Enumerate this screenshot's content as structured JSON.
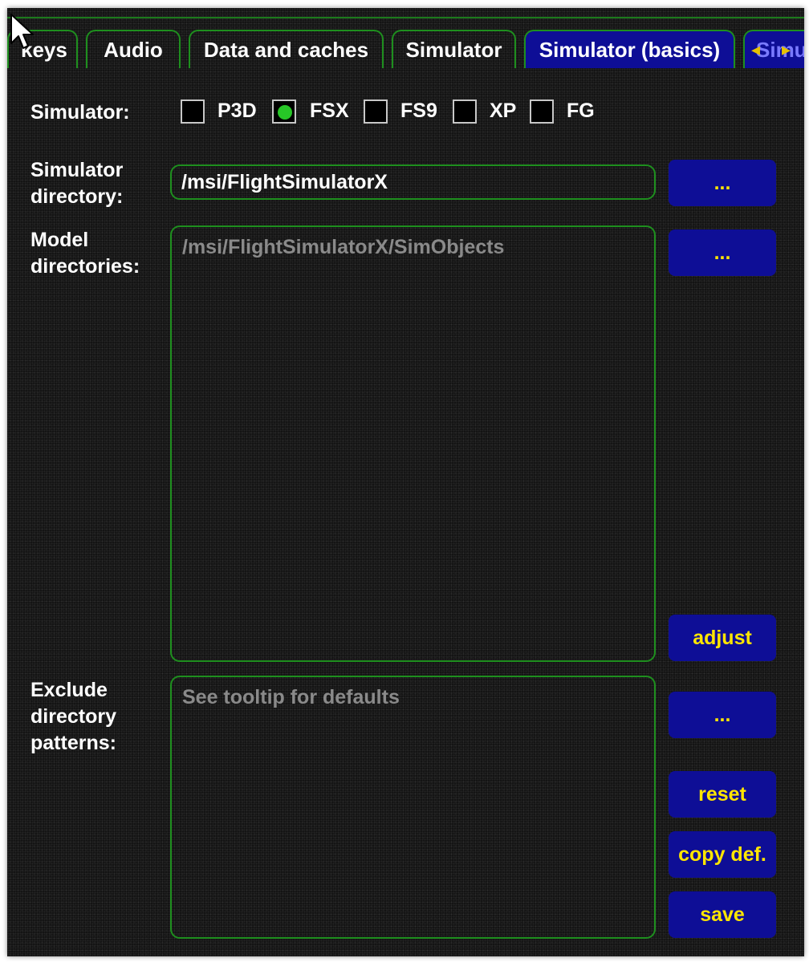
{
  "tabs": [
    {
      "label": "keys"
    },
    {
      "label": "Audio"
    },
    {
      "label": "Data and caches"
    },
    {
      "label": "Simulator"
    },
    {
      "label": "Simulator (basics)"
    },
    {
      "label": "Simu"
    }
  ],
  "simulator": {
    "label": "Simulator:",
    "options": [
      {
        "label": "P3D",
        "selected": false
      },
      {
        "label": "FSX",
        "selected": true
      },
      {
        "label": "FS9",
        "selected": false
      },
      {
        "label": "XP",
        "selected": false
      },
      {
        "label": "FG",
        "selected": false
      }
    ]
  },
  "sim_dir": {
    "label_line1": "Simulator",
    "label_line2": "directory:",
    "value": "/msi/FlightSimulatorX",
    "browse_label": "..."
  },
  "model_dirs": {
    "label_line1": "Model",
    "label_line2": "directories:",
    "placeholder": "/msi/FlightSimulatorX/SimObjects",
    "browse_label": "...",
    "adjust_label": "adjust"
  },
  "exclude": {
    "label_line1": "Exclude",
    "label_line2": "directory",
    "label_line3": "patterns:",
    "placeholder": "See tooltip for defaults",
    "browse_label": "...",
    "reset_label": "reset",
    "copy_label": "copy def.",
    "save_label": "save"
  },
  "colors": {
    "background": "#141414",
    "border_green": "#1e8f1e",
    "button_blue": "#0e0e96",
    "button_text": "#ffe600",
    "radio_green": "#27c727"
  }
}
